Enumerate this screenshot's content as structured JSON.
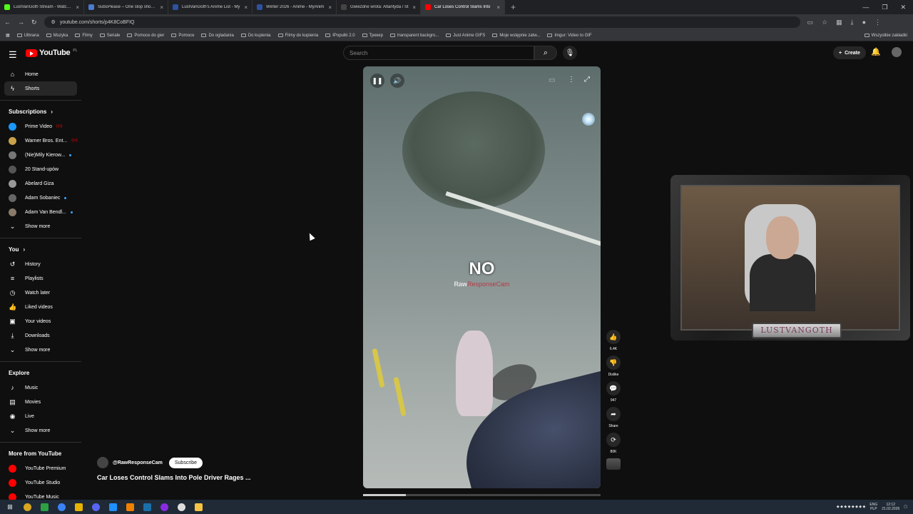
{
  "browser": {
    "tabs": [
      {
        "title": "LustVanGoth Stream - Watch Li",
        "color": "#53fc18"
      },
      {
        "title": "SubsPlease – One stop shop fo",
        "color": "#4a7bd0"
      },
      {
        "title": "LustVanGoth's Anime List - My",
        "color": "#2e51a2"
      },
      {
        "title": "Winter 2026 - Anime - MyAnim",
        "color": "#2e51a2"
      },
      {
        "title": "Gwiezdne wrota: Atlantyda / St",
        "color": "#444444"
      },
      {
        "title": "Car Loses Control Slams Into",
        "color": "#ff0000"
      }
    ],
    "url": "youtube.com/shorts/p4K8CoBFIQ",
    "bookmarks": [
      "Ulbrana",
      "Muzyka",
      "Filmy",
      "Seriale",
      "Pomoce do gier",
      "Pomoce",
      "Do ogladania",
      "Do kupienia",
      "Filmy do kupienia",
      "IPopulki 2.0",
      "Трекер",
      "transparent backgro...",
      "Just Anime GIFS",
      "Moje wstępnie zatw...",
      "Imgur: Video to GIF"
    ],
    "bookmarks_all": "Wszystkie zakładki"
  },
  "yt": {
    "logo": "YouTube",
    "country": "PL",
    "search_placeholder": "Search",
    "create": "Create"
  },
  "sidebar": {
    "top": [
      {
        "label": "Home",
        "icon": "home-icon",
        "glyph": "⌂"
      },
      {
        "label": "Shorts",
        "icon": "shorts-icon",
        "glyph": "ϟ"
      }
    ],
    "subs_heading": "Subscriptions",
    "subs": [
      {
        "label": "Prime Video",
        "color": "#1a98ff",
        "badge": "live"
      },
      {
        "label": "Warner Bros. Ent...",
        "color": "#c9a24a",
        "badge": "live"
      },
      {
        "label": "(Nie)Mily Kierow...",
        "color": "#777777",
        "badge": "dot"
      },
      {
        "label": "20 Stand-upów",
        "color": "#555555",
        "badge": ""
      },
      {
        "label": "Abelard Giza",
        "color": "#999999",
        "badge": ""
      },
      {
        "label": "Adam Sobaniec",
        "color": "#666666",
        "badge": "dot"
      },
      {
        "label": "Adam Van Bendl...",
        "color": "#8a7a6a",
        "badge": "dot"
      }
    ],
    "show_more": "Show more",
    "you_heading": "You",
    "you": [
      {
        "label": "History",
        "icon": "history-icon",
        "glyph": "↺"
      },
      {
        "label": "Playlists",
        "icon": "playlists-icon",
        "glyph": "≡"
      },
      {
        "label": "Watch later",
        "icon": "watch-later-icon",
        "glyph": "◷"
      },
      {
        "label": "Liked videos",
        "icon": "liked-videos-icon",
        "glyph": "👍"
      },
      {
        "label": "Your videos",
        "icon": "your-videos-icon",
        "glyph": "▣"
      },
      {
        "label": "Downloads",
        "icon": "downloads-icon",
        "glyph": "⤓"
      }
    ],
    "explore_heading": "Explore",
    "explore": [
      {
        "label": "Music",
        "icon": "music-icon",
        "glyph": "♪"
      },
      {
        "label": "Movies",
        "icon": "movies-icon",
        "glyph": "▤"
      },
      {
        "label": "Live",
        "icon": "live-icon",
        "glyph": "◉"
      }
    ],
    "more_heading": "More from YouTube",
    "more": [
      {
        "label": "YouTube Premium"
      },
      {
        "label": "YouTube Studio"
      },
      {
        "label": "YouTube Music"
      }
    ]
  },
  "video": {
    "caption": "NO",
    "watermark_a": "Raw",
    "watermark_b": "ResponseCam",
    "progress": 0.18,
    "channel": "@RawResponseCam",
    "subscribe": "Subscribe",
    "title": "Car Loses Control Slams Into Pole Driver Rages ..."
  },
  "actions": [
    {
      "name": "like-button",
      "icon": "thumbs-up-icon",
      "glyph": "👍",
      "label": "6.4K"
    },
    {
      "name": "dislike-button",
      "icon": "thumbs-down-icon",
      "glyph": "👎",
      "label": "Dislike"
    },
    {
      "name": "comments-button",
      "icon": "comment-icon",
      "glyph": "💬",
      "label": "947"
    },
    {
      "name": "share-button",
      "icon": "share-icon",
      "glyph": "➦",
      "label": "Share"
    },
    {
      "name": "remix-button",
      "icon": "remix-icon",
      "glyph": "⟳",
      "label": "80K"
    }
  ],
  "overlay": {
    "nameplate": "LUSTVANGOTH"
  },
  "tray": {
    "lang": "ENG",
    "kb": "PLP",
    "time": "12:12",
    "date": "21.02.2026"
  }
}
